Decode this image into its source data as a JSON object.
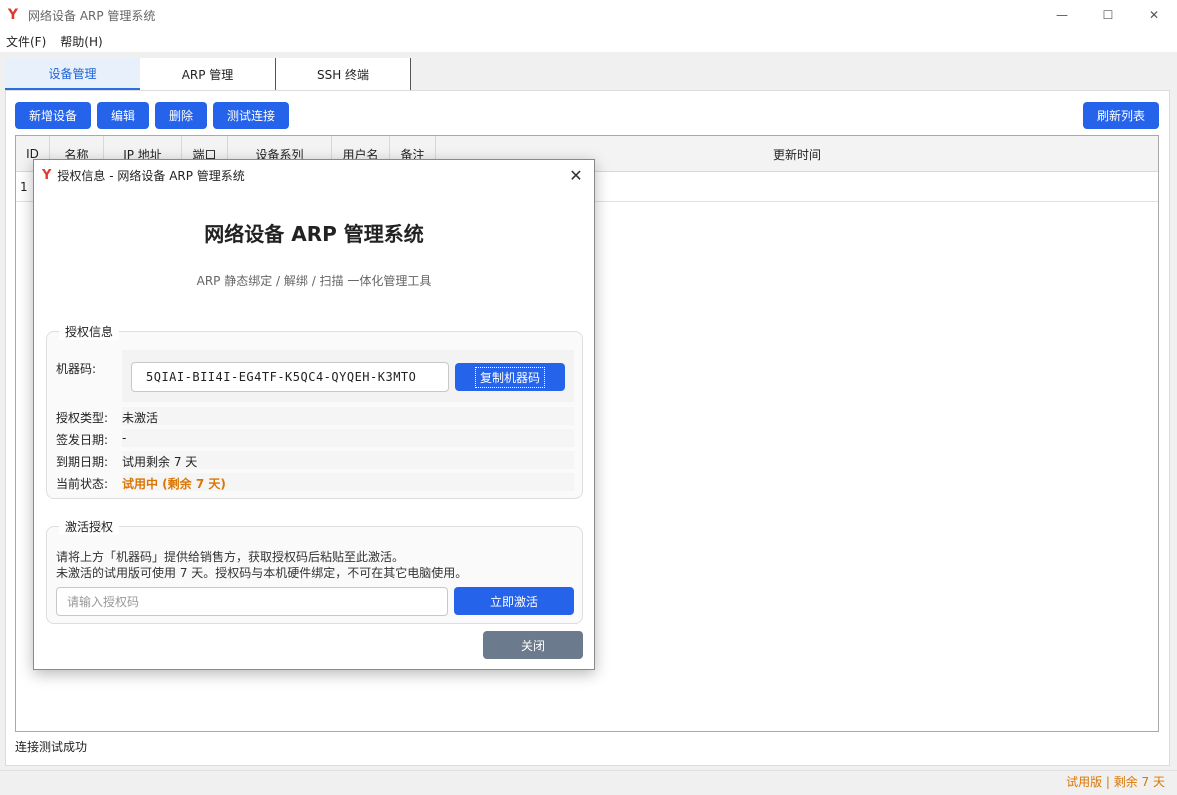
{
  "window": {
    "title": "网络设备 ARP 管理系统",
    "logo": "Y",
    "controls": [
      "—",
      "☐",
      "✕"
    ]
  },
  "menu": [
    "文件(F)",
    "帮助(H)"
  ],
  "tabs": [
    "设备管理",
    "ARP 管理",
    "SSH 终端"
  ],
  "toolbar": {
    "add": "新增设备",
    "edit": "编辑",
    "delete": "删除",
    "test": "测试连接",
    "refresh": "刷新列表"
  },
  "table": {
    "columns": [
      "ID",
      "名称",
      "IP 地址",
      "端口",
      "设备系列",
      "用户名",
      "备注",
      "更新时间"
    ],
    "rows": [
      {
        "id": "1"
      }
    ]
  },
  "status": {
    "message": "连接测试成功",
    "trial": "试用版 | 剩余 7 天"
  },
  "dialog": {
    "logo": "Y",
    "title": "授权信息 - 网络设备 ARP 管理系统",
    "close_icon": "✕",
    "heading": "网络设备 ARP 管理系统",
    "subtitle": "ARP 静态绑定 / 解绑 / 扫描 一体化管理工具",
    "license": {
      "legend": "授权信息",
      "machine_label": "机器码:",
      "machine_code": "5QIAI-BII4I-EG4TF-K5QC4-QYQEH-K3MTO",
      "copy_button": "复制机器码",
      "type_label": "授权类型:",
      "type_value": "未激活",
      "issue_label": "签发日期:",
      "issue_value": "-",
      "expire_label": "到期日期:",
      "expire_value": "试用剩余 7 天",
      "state_label": "当前状态:",
      "state_value": "试用中 (剩余 7 天)",
      "state_color": "#d97706"
    },
    "activate": {
      "legend": "激活授权",
      "line1": "请将上方「机器码」提供给销售方，获取授权码后粘贴至此激活。",
      "line2": "未激活的试用版可使用 7 天。授权码与本机硬件绑定，不可在其它电脑使用。",
      "placeholder": "请输入授权码",
      "button": "立即激活"
    },
    "close_button": "关闭"
  },
  "colors": {
    "primary": "#2563eb",
    "trial": "#d97706",
    "logo": "#e03a2f"
  }
}
